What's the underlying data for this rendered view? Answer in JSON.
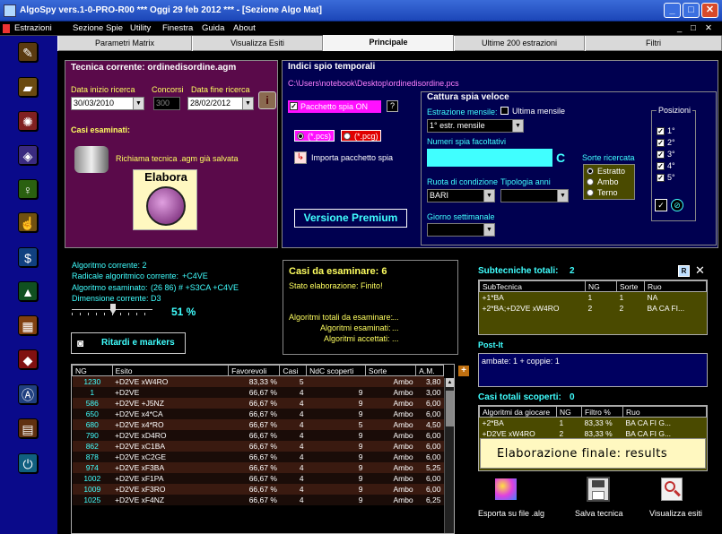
{
  "window": {
    "title": "AlgoSpy vers.1-0-PRO-R00  ***  Oggi 29 feb 2012  ***   - [Sezione Algo Mat]"
  },
  "menu": [
    "Estrazioni",
    "Sezione Spie",
    "Utility",
    "Finestra",
    "Guida",
    "About"
  ],
  "tabs": [
    "Parametri Matrix",
    "Visualizza Esiti",
    "Principale",
    "Ultime 200 estrazioni",
    "Filtri"
  ],
  "tecnica": {
    "title": "Tecnica corrente: ordinedisordine.agm",
    "data_inizio_label": "Data inizio ricerca",
    "data_inizio": "30/03/2010",
    "concorsi_label": "Concorsi",
    "concorsi": "300",
    "data_fine_label": "Data fine ricerca",
    "data_fine": "28/02/2012",
    "casi_label": "Casi esaminati:",
    "richiama": "Richiama tecnica .agm già salvata",
    "elabora": "Elabora"
  },
  "indici": {
    "title": "Indici spio temporali",
    "path": "C:\\Users\\notebook\\Desktop\\ordinedisordine.pcs",
    "pacchetto": "Pacchetto spia ON",
    "help": "?",
    "pcs": "(*.pcs)",
    "pcg": "(*.pcg)",
    "importa": "Importa pacchetto spia",
    "premium": "Versione Premium"
  },
  "cattura": {
    "title": "Cattura spia veloce",
    "estr_label": "Estrazione mensile:",
    "ultima": "Ultima mensile",
    "estr_value": "1° estr. mensile",
    "numeri_label": "Numeri spia facoltativi",
    "c_symbol": "C",
    "ruota_label": "Ruota di condizione",
    "ruota": "BARI",
    "tipologia_label": "Tipologia anni",
    "giorno_label": "Giorno settimanale",
    "sorte_label": "Sorte ricercata",
    "sorte": [
      "Estratto",
      "Ambo",
      "Terno"
    ],
    "posizioni_label": "Posizioni",
    "posizioni": [
      "1°",
      "2°",
      "3°",
      "4°",
      "5°"
    ]
  },
  "algo": {
    "corrente": "Algoritmo corrente: 2",
    "radicale_label": "Radicale algoritmico corrente:",
    "radicale": "+C4VE",
    "esaminato_label": "Algoritmo esaminato:",
    "esaminato": "(26 86) # +S3CA +C4VE",
    "dimensione_label": "Dimensione corrente:",
    "dimensione": "D3",
    "percent": "51 %",
    "ritardi": "Ritardi e markers"
  },
  "casi": {
    "title": "Casi da esaminare: 6",
    "stato": "Stato elaborazione: Finito!",
    "tot_label": "Algoritmi totali da esaminare:",
    "tot": "...",
    "esam_label": "Algoritmi esaminati:",
    "esam": "...",
    "acc_label": "Algoritmi accettati:",
    "acc": "..."
  },
  "main_table": {
    "headers": [
      "NG",
      "Esito",
      "Favorevoli",
      "Casi",
      "NdC scoperti",
      "Sorte",
      "A.M."
    ],
    "rows": [
      [
        "1230",
        "+D2VE xW4RO",
        "83,33 %",
        "5",
        "",
        "Ambo",
        "3,80"
      ],
      [
        "1",
        "+D2VE",
        "66,67 %",
        "4",
        "9",
        "Ambo",
        "3,00"
      ],
      [
        "586",
        "+D2VE +J5NZ",
        "66,67 %",
        "4",
        "9",
        "Ambo",
        "6,00"
      ],
      [
        "650",
        "+D2VE x4*CA",
        "66,67 %",
        "4",
        "9",
        "Ambo",
        "6,00"
      ],
      [
        "680",
        "+D2VE x4*RO",
        "66,67 %",
        "4",
        "5",
        "Ambo",
        "4,50"
      ],
      [
        "790",
        "+D2VE xD4RO",
        "66,67 %",
        "4",
        "9",
        "Ambo",
        "6,00"
      ],
      [
        "862",
        "+D2VE xC1BA",
        "66,67 %",
        "4",
        "9",
        "Ambo",
        "6,00"
      ],
      [
        "878",
        "+D2VE xC2GE",
        "66,67 %",
        "4",
        "9",
        "Ambo",
        "6,00"
      ],
      [
        "974",
        "+D2VE xF3BA",
        "66,67 %",
        "4",
        "9",
        "Ambo",
        "5,25"
      ],
      [
        "1002",
        "+D2VE xF1PA",
        "66,67 %",
        "4",
        "9",
        "Ambo",
        "6,00"
      ],
      [
        "1009",
        "+D2VE xF3RO",
        "66,67 %",
        "4",
        "9",
        "Ambo",
        "6,00"
      ],
      [
        "1025",
        "+D2VE xF4NZ",
        "66,67 %",
        "4",
        "9",
        "Ambo",
        "6,25"
      ]
    ]
  },
  "subtec": {
    "title": "Subtecniche totali:",
    "count": "2",
    "headers": [
      "SubTecnica",
      "NG",
      "Sorte",
      "Ruo"
    ],
    "rows": [
      [
        "+1*BA",
        "1",
        "1",
        "NA"
      ],
      [
        "+2*BA;+D2VE xW4RO",
        "2",
        "2",
        "BA CA FI..."
      ]
    ]
  },
  "postit": {
    "title": "Post-It",
    "text": "ambate: 1 + coppie: 1"
  },
  "casitot": {
    "title": "Casi totali scoperti:",
    "count": "0",
    "headers": [
      "Algoritmi da giocare",
      "NG",
      "Filtro %",
      "Ruo"
    ],
    "rows": [
      [
        "+2*BA",
        "1",
        "83,33 %",
        "BA CA FI G..."
      ],
      [
        "+D2VE xW4RO",
        "2",
        "83,33 %",
        "BA CA FI G..."
      ]
    ]
  },
  "tooltip": "Elaborazione finale: results",
  "bottom": {
    "esporta": "Esporta su file .alg",
    "salva": "Salva tecnica",
    "visualizza": "Visualizza esiti"
  },
  "colors": {
    "purple_panel": "#5a0a4a",
    "navy_panel": "#000050",
    "magenta": "#ff10ff",
    "cyan": "#40ffff",
    "olive_grid": "#4a4a00"
  }
}
